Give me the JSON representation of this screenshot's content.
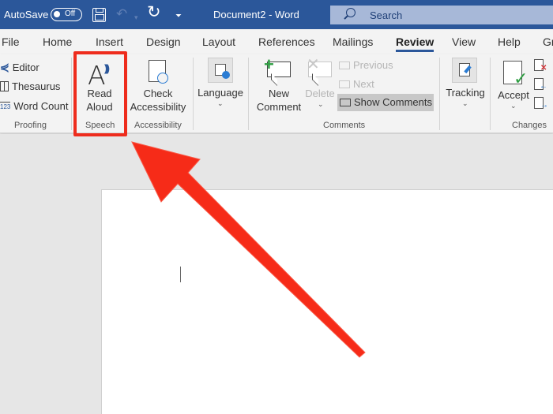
{
  "titlebar": {
    "autosave_label": "AutoSave",
    "autosave_state": "Off",
    "document_title": "Document2  -  Word",
    "search_placeholder": "Search",
    "icons": [
      "save-icon",
      "undo-icon",
      "redo-icon",
      "customize-quick-access-icon"
    ]
  },
  "tabs": [
    {
      "label": "File"
    },
    {
      "label": "Home"
    },
    {
      "label": "Insert"
    },
    {
      "label": "Design"
    },
    {
      "label": "Layout"
    },
    {
      "label": "References"
    },
    {
      "label": "Mailings"
    },
    {
      "label": "Review",
      "active": true
    },
    {
      "label": "View"
    },
    {
      "label": "Help"
    },
    {
      "label": "Gr"
    }
  ],
  "ribbon": {
    "proofing": {
      "label": "Proofing",
      "items": [
        "Editor",
        "Thesaurus",
        "Word Count"
      ]
    },
    "speech": {
      "label": "Speech",
      "read_aloud_line1": "Read",
      "read_aloud_line2": "Aloud"
    },
    "accessibility": {
      "label": "Accessibility",
      "check_line1": "Check",
      "check_line2": "Accessibility"
    },
    "language": {
      "label": "Language"
    },
    "comments": {
      "label": "Comments",
      "new_line1": "New",
      "new_line2": "Comment",
      "delete": "Delete",
      "previous": "Previous",
      "next": "Next",
      "show_comments": "Show Comments"
    },
    "tracking": {
      "label": "Tracking"
    },
    "changes": {
      "label": "Changes",
      "accept": "Accept"
    }
  },
  "annotation": {
    "highlight_color": "#ee2c1d",
    "target": "Read Aloud"
  },
  "colors": {
    "titlebar": "#2b579a",
    "ribbon": "#f3f3f3",
    "canvas": "#e6e6e6"
  }
}
